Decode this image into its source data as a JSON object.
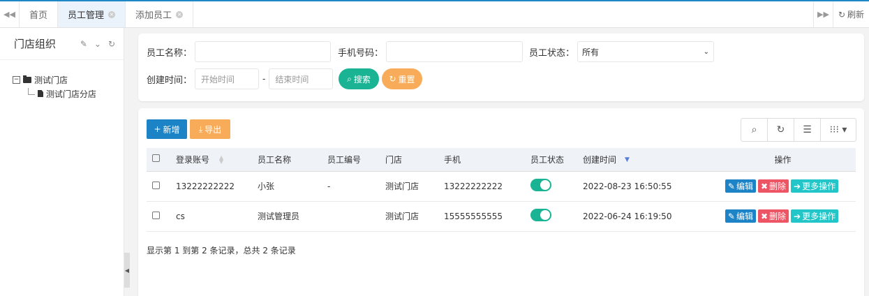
{
  "tabs": {
    "items": [
      {
        "label": "首页"
      },
      {
        "label": "员工管理"
      },
      {
        "label": "添加员工"
      }
    ],
    "refresh_label": "刷新"
  },
  "left": {
    "title": "门店组织",
    "tree": {
      "root": "测试门店",
      "child": "测试门店分店"
    }
  },
  "search": {
    "name_label": "员工名称：",
    "phone_label": "手机号码：",
    "status_label": "员工状态：",
    "status_value": "所有",
    "created_label": "创建时间：",
    "start_placeholder": "开始时间",
    "end_placeholder": "结束时间",
    "range_sep": "-",
    "search_button": "搜索",
    "reset_button": "重置"
  },
  "toolbar": {
    "add_label": "新增",
    "export_label": "导出"
  },
  "table": {
    "columns": [
      "登录账号",
      "员工名称",
      "员工编号",
      "门店",
      "手机",
      "员工状态",
      "创建时间",
      "操作"
    ],
    "rows": [
      {
        "account": "13222222222",
        "name": "小张",
        "code": "-",
        "store": "测试门店",
        "phone": "13222222222",
        "created": "2022-08-23 16:50:55"
      },
      {
        "account": "cs",
        "name": "测试管理员",
        "code": "",
        "store": "测试门店",
        "phone": "15555555555",
        "created": "2022-06-24 16:19:50"
      }
    ],
    "actions": {
      "edit": "编辑",
      "delete": "删除",
      "more": "更多操作"
    }
  },
  "pager_text": "显示第 1 到第 2 条记录，总共 2 条记录",
  "colors": {
    "primary": "#1c84c6",
    "success": "#1ab394",
    "warning": "#f8ac59",
    "danger": "#ed5565",
    "info": "#23c6c8"
  }
}
